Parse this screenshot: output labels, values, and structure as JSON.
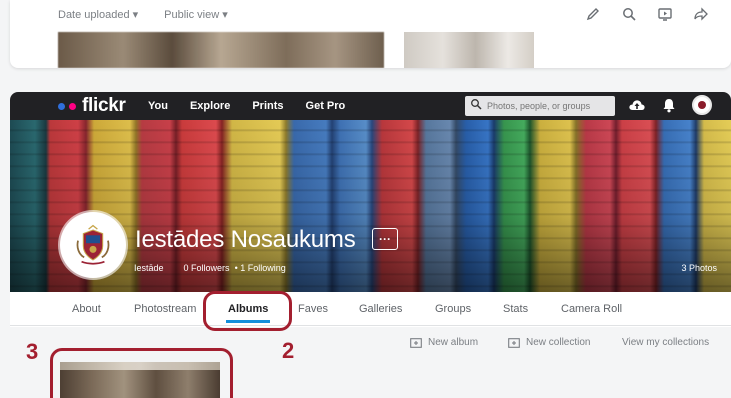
{
  "top_bar": {
    "filters": [
      "Date uploaded ▾",
      "Public view ▾"
    ],
    "icons": [
      "edit-icon",
      "search-icon",
      "slideshow-icon",
      "share-icon"
    ]
  },
  "nav": {
    "logo": "flickr",
    "links": [
      "You",
      "Explore",
      "Prints",
      "Get Pro"
    ],
    "search_placeholder": "Photos, people, or groups",
    "icons": [
      "upload-icon",
      "notifications-icon",
      "avatar"
    ]
  },
  "profile": {
    "name": "Iestādes Nosaukums",
    "username": "Iestāde",
    "followers": "0 Followers",
    "following": "• 1 Following",
    "photos": "3 Photos",
    "more_label": "···"
  },
  "tabs": [
    "About",
    "Photostream",
    "Albums",
    "Faves",
    "Galleries",
    "Groups",
    "Stats",
    "Camera Roll"
  ],
  "active_tab": "Albums",
  "actions": {
    "new_album": "New album",
    "new_collection": "New collection",
    "view_collections": "View my collections"
  },
  "annotations": {
    "label_albums": "2",
    "label_album_thumb": "3",
    "color": "#a31f2f"
  },
  "colors": {
    "navbar": "#212124",
    "accent": "#128fdc",
    "logo_blue": "#2f6fdc",
    "logo_pink": "#ff0084"
  }
}
